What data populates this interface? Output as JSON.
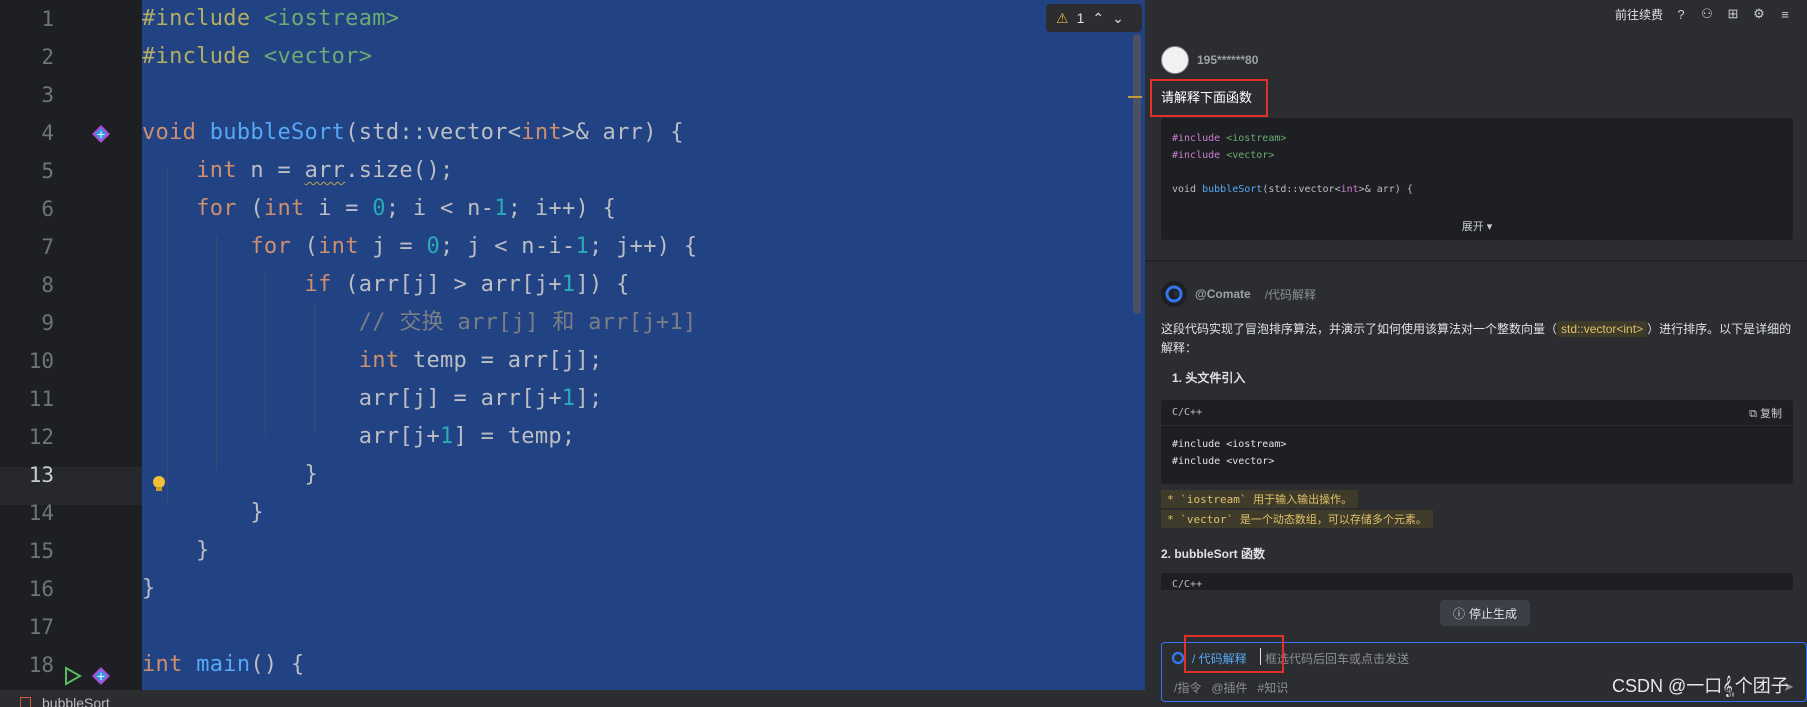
{
  "editor": {
    "lines": [
      {
        "n": "1",
        "segs": [
          [
            "pp",
            "#include "
          ],
          [
            "str",
            "<iostream>"
          ]
        ]
      },
      {
        "n": "2",
        "segs": [
          [
            "pp",
            "#include "
          ],
          [
            "str",
            "<vector>"
          ]
        ]
      },
      {
        "n": "3",
        "segs": []
      },
      {
        "n": "4",
        "segs": [
          [
            "kw",
            "void "
          ],
          [
            "fn",
            "bubbleSort"
          ],
          [
            "",
            "(std::vector<"
          ],
          [
            "kw",
            "int"
          ],
          [
            "",
            ">& arr) {"
          ]
        ]
      },
      {
        "n": "5",
        "segs": [
          [
            "",
            "    "
          ],
          [
            "kw",
            "int "
          ],
          [
            "",
            "n = "
          ],
          [
            "squig",
            "arr"
          ],
          [
            "",
            ".size();"
          ]
        ]
      },
      {
        "n": "6",
        "segs": [
          [
            "",
            "    "
          ],
          [
            "kw",
            "for "
          ],
          [
            "",
            "("
          ],
          [
            "kw",
            "int "
          ],
          [
            "",
            "i = "
          ],
          [
            "num",
            "0"
          ],
          [
            "",
            "; i < n-"
          ],
          [
            "num",
            "1"
          ],
          [
            "",
            "; i++) {"
          ]
        ]
      },
      {
        "n": "7",
        "segs": [
          [
            "",
            "        "
          ],
          [
            "kw",
            "for "
          ],
          [
            "",
            "("
          ],
          [
            "kw",
            "int "
          ],
          [
            "",
            "j = "
          ],
          [
            "num",
            "0"
          ],
          [
            "",
            "; j < n-i-"
          ],
          [
            "num",
            "1"
          ],
          [
            "",
            "; j++) {"
          ]
        ]
      },
      {
        "n": "8",
        "segs": [
          [
            "",
            "            "
          ],
          [
            "kw",
            "if "
          ],
          [
            "",
            "(arr[j] > arr[j+"
          ],
          [
            "num",
            "1"
          ],
          [
            "",
            "]) {"
          ]
        ]
      },
      {
        "n": "9",
        "segs": [
          [
            "",
            "                "
          ],
          [
            "cm",
            "// 交换 arr[j] 和 arr[j+1]"
          ]
        ]
      },
      {
        "n": "10",
        "segs": [
          [
            "",
            "                "
          ],
          [
            "kw",
            "int "
          ],
          [
            "",
            "temp = arr[j];"
          ]
        ]
      },
      {
        "n": "11",
        "segs": [
          [
            "",
            "                "
          ],
          [
            "",
            "arr[j] = arr[j+"
          ],
          [
            "num",
            "1"
          ],
          [
            "",
            "];"
          ]
        ]
      },
      {
        "n": "12",
        "segs": [
          [
            "",
            "                "
          ],
          [
            "",
            "arr[j+"
          ],
          [
            "num",
            "1"
          ],
          [
            "",
            "] = temp;"
          ]
        ]
      },
      {
        "n": "13",
        "segs": [
          [
            "",
            "            }"
          ]
        ]
      },
      {
        "n": "14",
        "segs": [
          [
            "",
            "        }"
          ]
        ]
      },
      {
        "n": "15",
        "segs": [
          [
            "",
            "    }"
          ]
        ]
      },
      {
        "n": "16",
        "segs": [
          [
            "",
            "}"
          ]
        ]
      },
      {
        "n": "17",
        "segs": []
      },
      {
        "n": "18",
        "segs": [
          [
            "kw",
            "int "
          ],
          [
            "fn",
            "main"
          ],
          [
            "",
            "() {"
          ]
        ]
      }
    ],
    "warning_count": "1",
    "status_file": "bubbleSort"
  },
  "topbar": {
    "renew_label": "前往续费"
  },
  "chat": {
    "user_name": "195******80",
    "question": "请解释下面函数",
    "snippet_lines": [
      [
        [
          "inc",
          "#include "
        ],
        [
          "hdr",
          "<iostream>"
        ]
      ],
      [
        [
          "inc",
          "#include "
        ],
        [
          "hdr",
          "<vector>"
        ]
      ],
      [],
      [
        [
          "",
          "void "
        ],
        [
          "tfn",
          "bubbleSort"
        ],
        [
          "",
          "(std::vector<"
        ],
        [
          "tkw",
          "int"
        ],
        [
          "",
          ">& arr) {"
        ]
      ]
    ],
    "expand_label": "展开 ▾",
    "bot_name": "@Comate",
    "bot_command": "/代码解释",
    "answer_pre": "这段代码实现了冒泡排序算法，并演示了如何使用该算法对一个整数向量（",
    "answer_chip": "std::vector<int>",
    "answer_post": "）进行排序。以下是详细的解释：",
    "heading1": "1. 头文件引入",
    "code_lang": "C/C++",
    "copy_label": "复制",
    "code_lines": [
      [
        [
          "inc",
          "#include "
        ],
        [
          "hdr",
          "<iostream>"
        ]
      ],
      [
        [
          "inc",
          "#include "
        ],
        [
          "hdr",
          "<vector>"
        ]
      ]
    ],
    "bullet1": "* `iostream` 用于输入输出操作。",
    "bullet2": "* `vector` 是一个动态数组，可以存储多个元素。",
    "heading2": "2. bubbleSort 函数",
    "code_lang2": "C/C++",
    "stop_label": "停止生成",
    "input_command": "/ 代码解释",
    "input_placeholder": "框选代码后回车或点击发送",
    "tool_cmd": "/指令",
    "tool_plugin": "@插件",
    "tool_knowledge": "#知识"
  },
  "watermark": "CSDN @一口𝄠个团子",
  "colors": {
    "editor_bg": "#1e1f22",
    "selection_bg": "#214283",
    "panel_bg": "#2b2d30",
    "highlight_red": "#e0312b",
    "accent_blue": "#3574f0"
  }
}
